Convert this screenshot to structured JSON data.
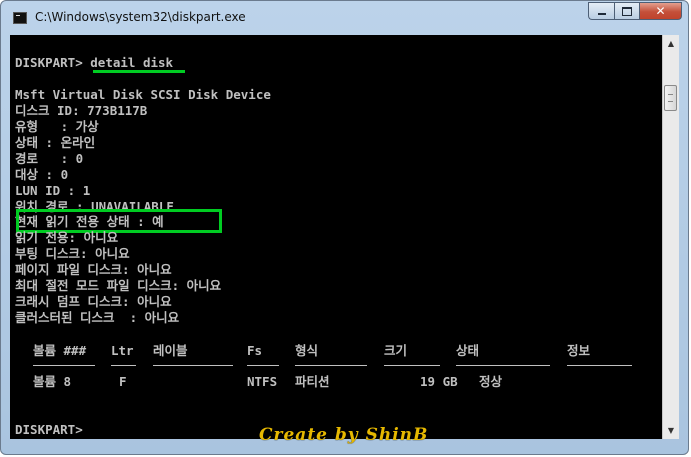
{
  "window": {
    "title": "C:\\Windows\\system32\\diskpart.exe",
    "icon": "console-app-icon",
    "controls": {
      "minimize_icon": "minimize-icon",
      "maximize_icon": "maximize-icon",
      "close_glyph": "✕"
    }
  },
  "console": {
    "prompt_line": "DISKPART> ",
    "command": "detail disk",
    "lines": [
      "Msft Virtual Disk SCSI Disk Device",
      "디스크 ID: 773B117B",
      "유형   : 가상",
      "상태 : 온라인",
      "경로   : 0",
      "대상 : 0",
      "LUN ID : 1",
      "위치 경로 : UNAVAILABLE",
      "현재 읽기 전용 상태 : 예",
      "읽기 전용: 아니요",
      "부팅 디스크: 아니요",
      "페이지 파일 디스크: 아니요",
      "최대 절전 모드 파일 디스크: 아니요",
      "크래시 덤프 디스크: 아니요",
      "클러스터된 디스크  : 아니요"
    ],
    "table": {
      "headers": [
        "볼륨 ###",
        "Ltr",
        "레이블",
        "Fs",
        "형식",
        "크기",
        "상태",
        "정보"
      ],
      "rows": [
        [
          "볼륨 8",
          "F",
          "",
          "NTFS",
          "파티션",
          "19 GB",
          "정상",
          ""
        ]
      ]
    },
    "final_prompt": "DISKPART> "
  },
  "annotations": {
    "highlight_color": "#00cc22",
    "watermark": "Create by ShinB",
    "watermark_color": "#e6b800"
  },
  "scrollbar": {
    "up_arrow": "▲",
    "down_arrow": "▼"
  }
}
